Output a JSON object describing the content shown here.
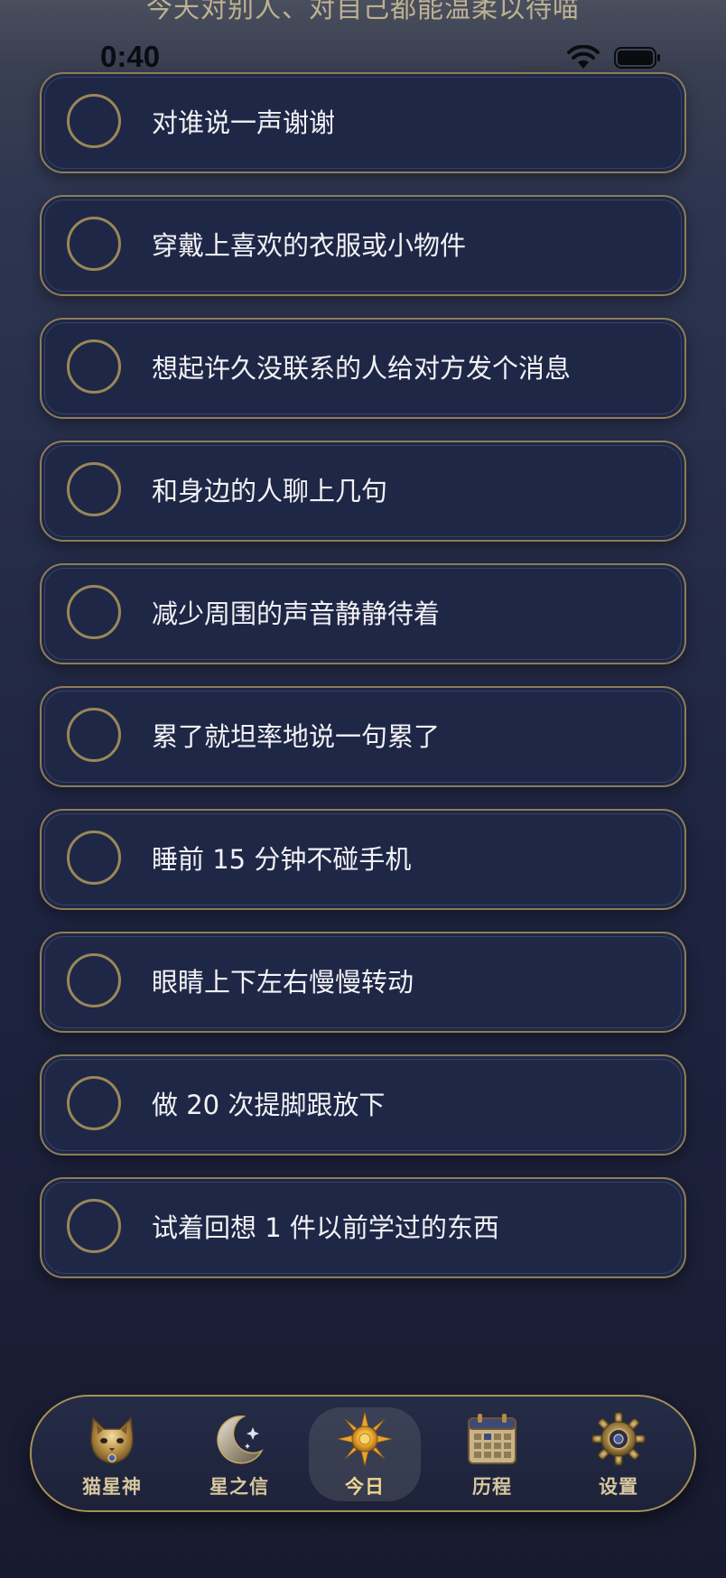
{
  "header": {
    "banner_text": "今天对别人、对自己都能温柔以待喵"
  },
  "status_bar": {
    "time": "0:40"
  },
  "tasks": [
    {
      "label": "对谁说一声谢谢",
      "checked": false
    },
    {
      "label": "穿戴上喜欢的衣服或小物件",
      "checked": false
    },
    {
      "label": "想起许久没联系的人给对方发个消息",
      "checked": false
    },
    {
      "label": "和身边的人聊上几句",
      "checked": false
    },
    {
      "label": "减少周围的声音静静待着",
      "checked": false
    },
    {
      "label": "累了就坦率地说一句累了",
      "checked": false
    },
    {
      "label": "睡前 15 分钟不碰手机",
      "checked": false
    },
    {
      "label": "眼睛上下左右慢慢转动",
      "checked": false
    },
    {
      "label": "做 20 次提脚跟放下",
      "checked": false
    },
    {
      "label": "试着回想 1 件以前学过的东西",
      "checked": false
    }
  ],
  "tab_bar": {
    "selected": "今日",
    "tabs": [
      {
        "label": "猫星神",
        "icon": "cat-icon"
      },
      {
        "label": "星之信",
        "icon": "crescent-moon-icon"
      },
      {
        "label": "今日",
        "icon": "sun-icon"
      },
      {
        "label": "历程",
        "icon": "calendar-icon"
      },
      {
        "label": "设置",
        "icon": "gear-icon"
      }
    ]
  },
  "colors": {
    "gold_accent": "#a89058",
    "card_background": "#1f2746",
    "text_primary": "#f2f2f5"
  }
}
